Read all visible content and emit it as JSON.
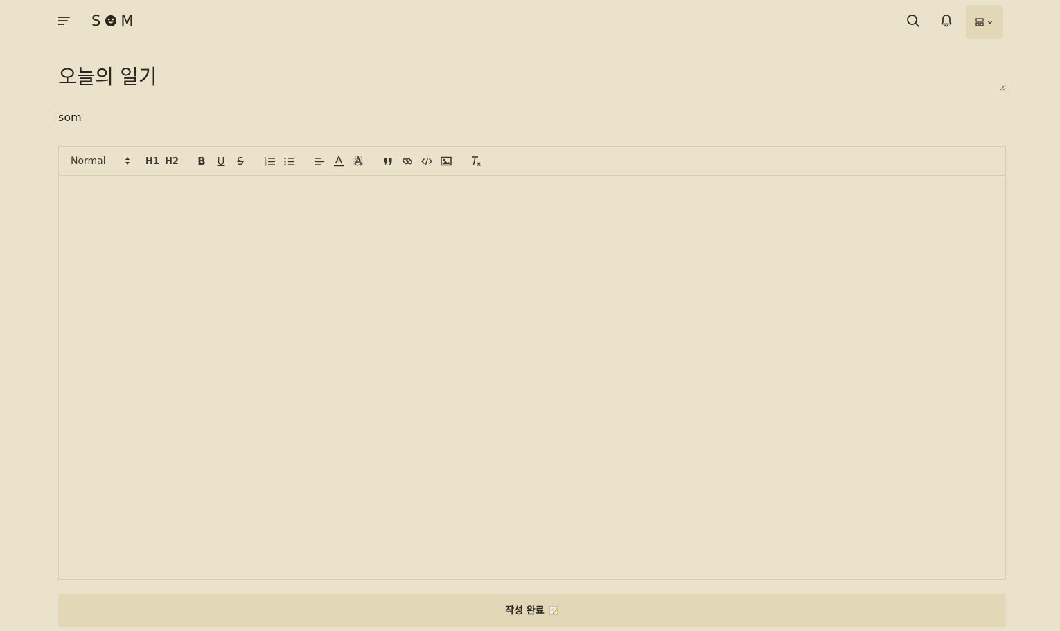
{
  "header": {
    "logo_left": "S",
    "logo_right": "M",
    "menu_icon": "menu-lines-icon",
    "search_icon": "search-icon",
    "bell_icon": "bell-icon",
    "layout_icon": "layout-grid-icon"
  },
  "post": {
    "title_value": "오늘의 일기",
    "author": "som"
  },
  "editor": {
    "size_label": "Normal",
    "h1_label": "H1",
    "h2_label": "H2",
    "bold_label": "B",
    "underline_label": "U",
    "strike_label": "S"
  },
  "submit": {
    "label": "작성 완료"
  },
  "colors": {
    "background": "#EAE2CA",
    "button_bg": "#E2D8B7",
    "border": "#D6CDB2",
    "text": "#2b2520"
  }
}
